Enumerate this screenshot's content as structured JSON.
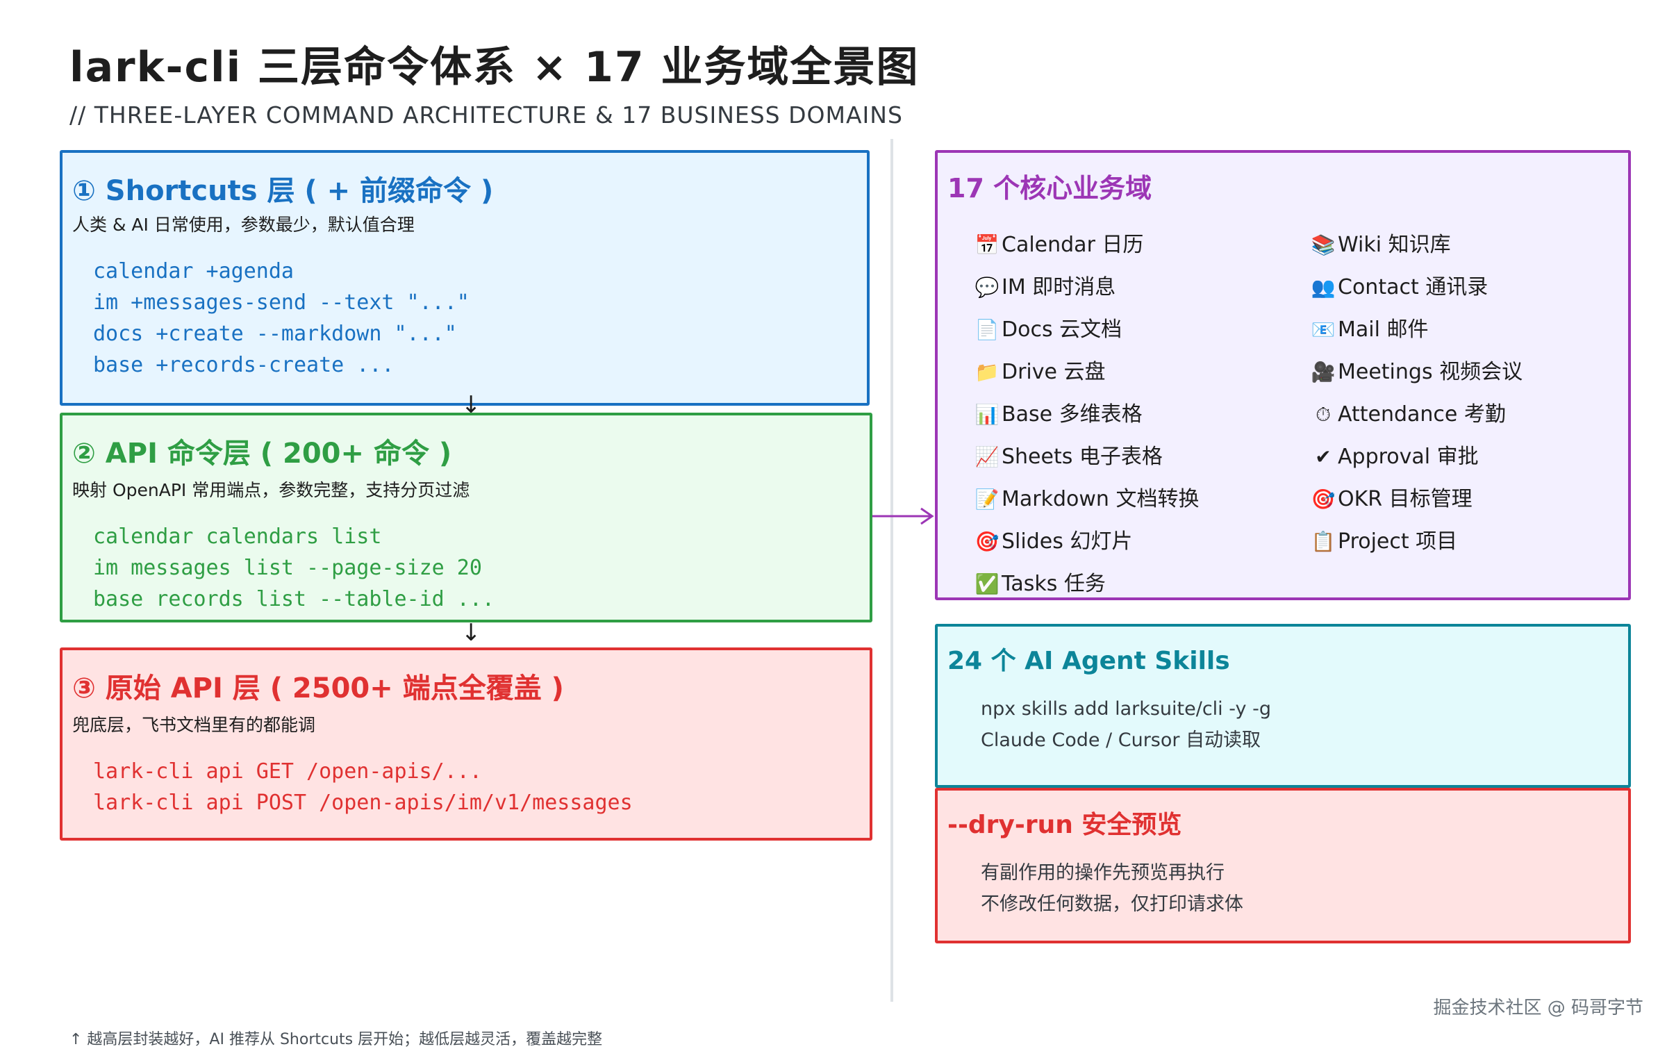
{
  "title": "lark-cli 三层命令体系 × 17 业务域全景图",
  "subtitle": "// THREE-LAYER COMMAND ARCHITECTURE & 17 BUSINESS DOMAINS",
  "layers": {
    "shortcuts": {
      "title": "① Shortcuts 层 ( + 前缀命令 )",
      "desc": "人类 & AI 日常使用，参数最少，默认值合理",
      "code": [
        "calendar +agenda",
        "im +messages-send --text \"...\"",
        "docs +create --markdown \"...\"",
        "base +records-create ..."
      ]
    },
    "api": {
      "title": "② API 命令层 ( 200+ 命令 )",
      "desc": "映射 OpenAPI 常用端点，参数完整，支持分页过滤",
      "code": [
        "calendar calendars list",
        "im messages list --page-size 20",
        "base records list --table-id ..."
      ]
    },
    "raw": {
      "title": "③ 原始 API 层 ( 2500+ 端点全覆盖 )",
      "desc": "兜底层，飞书文档里有的都能调",
      "code": [
        "lark-cli api GET /open-apis/...",
        "lark-cli api POST /open-apis/im/v1/messages"
      ]
    }
  },
  "domains": {
    "title": "17 个核心业务域",
    "left": [
      {
        "icon": "📅",
        "icon_name": "calendar-icon",
        "label": "Calendar 日历"
      },
      {
        "icon": "💬",
        "icon_name": "speech-bubble-icon",
        "label": "IM 即时消息"
      },
      {
        "icon": "📄",
        "icon_name": "document-icon",
        "label": "Docs 云文档"
      },
      {
        "icon": "📁",
        "icon_name": "folder-icon",
        "label": "Drive 云盘"
      },
      {
        "icon": "📊",
        "icon_name": "bar-chart-icon",
        "label": "Base 多维表格"
      },
      {
        "icon": "📈",
        "icon_name": "line-chart-icon",
        "label": "Sheets 电子表格"
      },
      {
        "icon": "📝",
        "icon_name": "memo-icon",
        "label": "Markdown 文档转换"
      },
      {
        "icon": "🎯",
        "icon_name": "target-icon",
        "label": "Slides 幻灯片"
      },
      {
        "icon": "✅",
        "icon_name": "check-box-icon",
        "label": "Tasks 任务"
      }
    ],
    "right": [
      {
        "icon": "📚",
        "icon_name": "books-icon",
        "label": "Wiki 知识库"
      },
      {
        "icon": "👥",
        "icon_name": "people-icon",
        "label": "Contact 通讯录"
      },
      {
        "icon": "📧",
        "icon_name": "mail-icon",
        "label": "Mail 邮件"
      },
      {
        "icon": "🎥",
        "icon_name": "video-camera-icon",
        "label": "Meetings 视频会议"
      },
      {
        "icon": "⏱",
        "icon_name": "stopwatch-icon",
        "label": "Attendance 考勤"
      },
      {
        "icon": "✔",
        "icon_name": "check-mark-icon",
        "label": "Approval 审批"
      },
      {
        "icon": "🎯",
        "icon_name": "target-icon",
        "label": "OKR 目标管理"
      },
      {
        "icon": "📋",
        "icon_name": "clipboard-icon",
        "label": "Project 项目"
      }
    ]
  },
  "skills": {
    "title": "24 个 AI Agent Skills",
    "lines": [
      "npx skills add larksuite/cli -y -g",
      "Claude Code / Cursor 自动读取"
    ]
  },
  "dryrun": {
    "title": "--dry-run 安全预览",
    "lines": [
      "有副作用的操作先预览再执行",
      "不修改任何数据，仅打印请求体"
    ]
  },
  "footer_note": "↑ 越高层封装越好，AI 推荐从 Shortcuts 层开始；越低层越灵活，覆盖越完整",
  "watermark": "掘金技术社区 @ 码哥字节",
  "colors": {
    "blue": "#1971c2",
    "blue_bg": "#e7f5ff",
    "green": "#2f9e44",
    "green_bg": "#ebfbee",
    "red": "#e03131",
    "red_bg": "#ffe3e3",
    "purple": "#9c36b5",
    "purple_bg": "#f3f0ff",
    "cyan": "#0c8599",
    "cyan_bg": "#e3fafc"
  }
}
